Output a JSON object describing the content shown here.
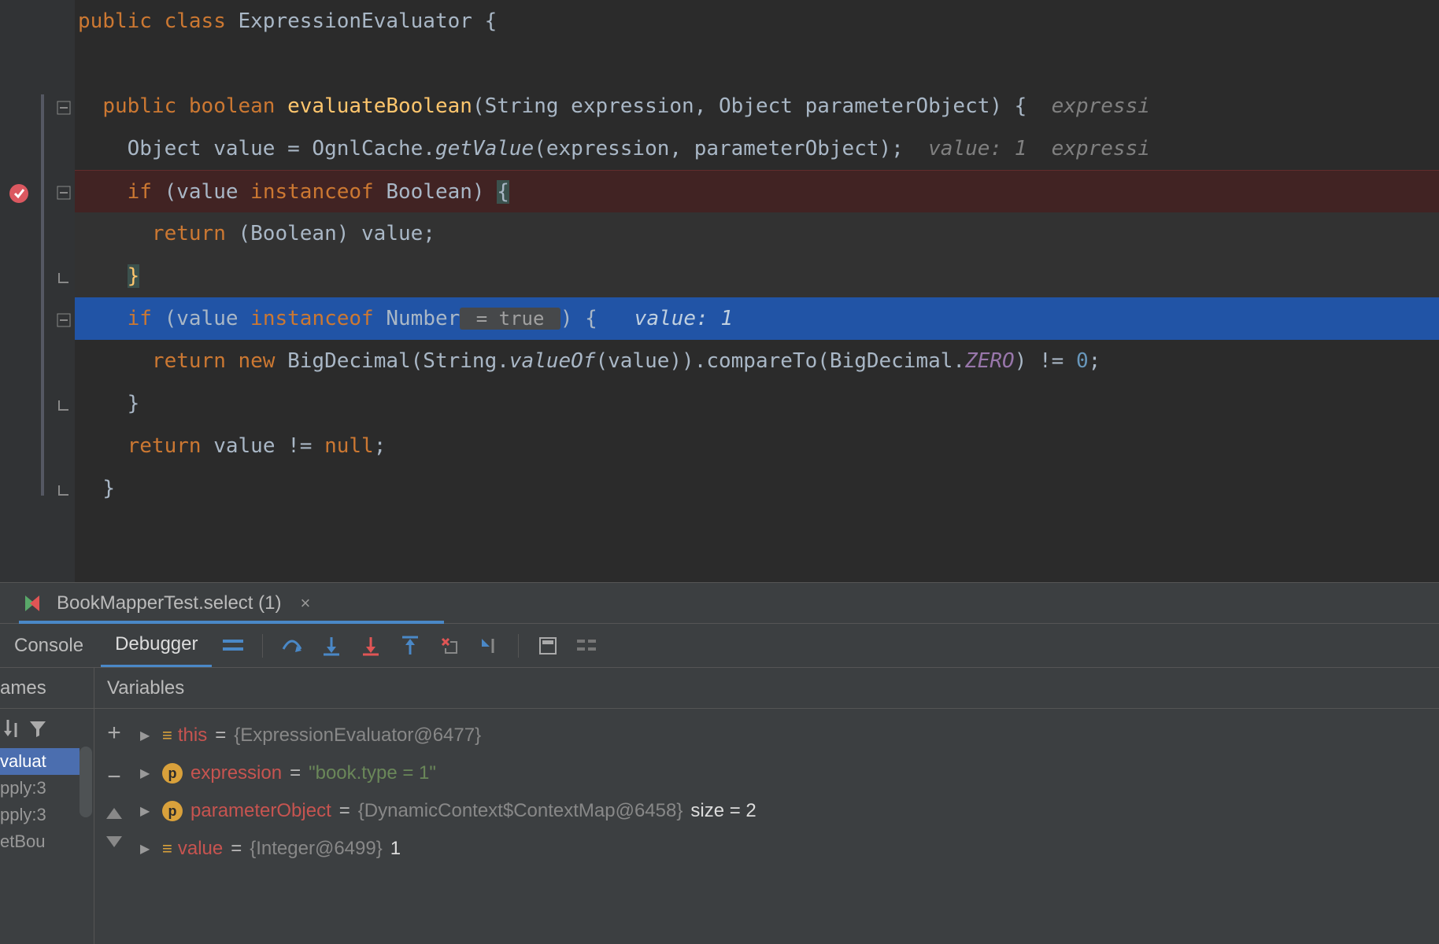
{
  "code": {
    "class_decl": {
      "public": "public ",
      "class": "class ",
      "name": "ExpressionEvaluator ",
      "brace": "{"
    },
    "method_sig": {
      "public": "public ",
      "boolean": "boolean ",
      "name": "evaluateBoolean",
      "params": "(String expression, Object parameterObject) {",
      "hint": "  expressi"
    },
    "line_value": {
      "pre": "Object value = OgnlCache.",
      "call": "getValue",
      "post": "(expression, parameterObject);",
      "hint1": "  value: 1",
      "hint2": "  expressi"
    },
    "line_if_bool": {
      "if": "if ",
      "open": "(value ",
      "instanceof": "instanceof ",
      "type": "Boolean) ",
      "brace": "{"
    },
    "line_ret_bool": {
      "return": "return ",
      "cast": "(Boolean) value;"
    },
    "close_brace1": "}",
    "line_if_num": {
      "if": "if ",
      "open": "(value ",
      "instanceof": "instanceof ",
      "type": "Number",
      "inline": " = true ",
      "close": ") {",
      "hint": "   value: 1"
    },
    "line_ret_num": {
      "return": "return ",
      "new": "new ",
      "cls": "BigDecimal(String.",
      "valueof": "valueOf",
      "mid": "(value)).compareTo(BigDecimal.",
      "zero": "ZERO",
      "end": ") != ",
      "num": "0",
      "semi": ";"
    },
    "close_brace2": "}",
    "line_ret_null": {
      "return": "return ",
      "rest": "value != ",
      "null": "null",
      "semi": ";"
    },
    "close_brace3": "}"
  },
  "debug_tab": {
    "title": "BookMapperTest.select (1)"
  },
  "toolbar": {
    "console": "Console",
    "debugger": "Debugger"
  },
  "frames": {
    "header": "ames",
    "rows": [
      "valuat",
      "pply:3",
      "pply:3",
      "etBou"
    ]
  },
  "variables": {
    "header": "Variables",
    "rows": [
      {
        "icon": "bars",
        "name": "this",
        "eq": " = ",
        "val": "{ExpressionEvaluator@6477} "
      },
      {
        "icon": "p",
        "name": "expression",
        "eq": " = ",
        "str": "\"book.type = 1\""
      },
      {
        "icon": "p",
        "name": "parameterObject",
        "eq": " = ",
        "val": "{DynamicContext$ContextMap@6458} ",
        "extra": " size = 2"
      },
      {
        "icon": "bars",
        "name": "value",
        "eq": " = ",
        "val": "{Integer@6499} ",
        "extra": "1"
      }
    ]
  }
}
